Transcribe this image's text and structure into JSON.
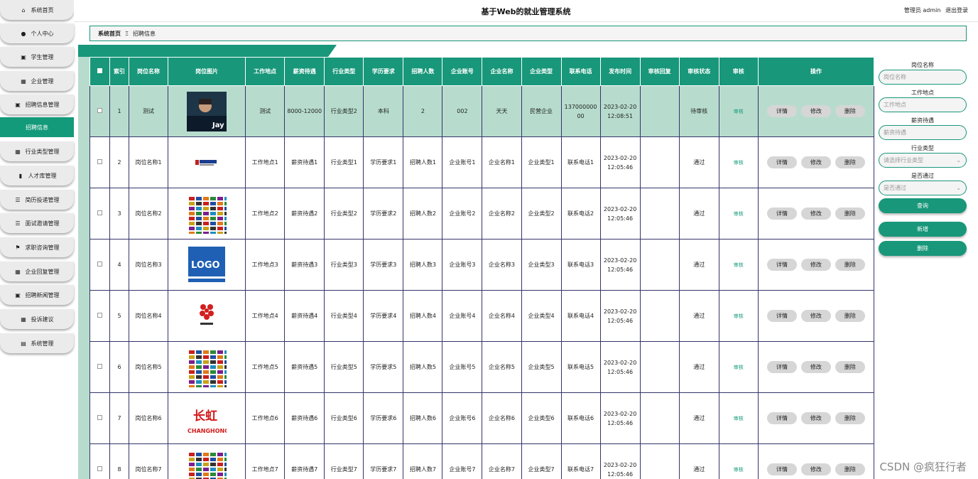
{
  "header": {
    "title": "基于Web的就业管理系统",
    "user": "管理员 admin",
    "logout": "退出登录"
  },
  "sidebar": {
    "items": [
      {
        "label": "系统首页",
        "icon": "home-icon",
        "glyph": "⌂"
      },
      {
        "label": "个人中心",
        "icon": "user-icon",
        "glyph": "●"
      },
      {
        "label": "学生管理",
        "icon": "clipboard-icon",
        "glyph": "▣"
      },
      {
        "label": "企业管理",
        "icon": "grid-icon",
        "glyph": "▦"
      },
      {
        "label": "招聘信息管理",
        "icon": "clipboard-icon",
        "glyph": "▣"
      },
      {
        "label": "招聘信息",
        "icon": "",
        "glyph": ""
      },
      {
        "label": "行业类型管理",
        "icon": "grid-icon",
        "glyph": "▦"
      },
      {
        "label": "人才库管理",
        "icon": "pin-icon",
        "glyph": "▮"
      },
      {
        "label": "简历投递管理",
        "icon": "list-icon",
        "glyph": "☰"
      },
      {
        "label": "面试邀请管理",
        "icon": "list-icon",
        "glyph": "☰"
      },
      {
        "label": "求职咨询管理",
        "icon": "flag-icon",
        "glyph": "⚑"
      },
      {
        "label": "企业回复管理",
        "icon": "grid-icon",
        "glyph": "▦"
      },
      {
        "label": "招聘新闻管理",
        "icon": "clipboard-icon",
        "glyph": "▣"
      },
      {
        "label": "投诉建议",
        "icon": "grid-icon",
        "glyph": "▦"
      },
      {
        "label": "系统管理",
        "icon": "server-icon",
        "glyph": "▤"
      }
    ]
  },
  "breadcrumb": {
    "home": "系统首页",
    "sep": "Ξ",
    "current": "招聘信息"
  },
  "table": {
    "headers": [
      "索引",
      "岗位名称",
      "岗位图片",
      "工作地点",
      "薪资待遇",
      "行业类型",
      "学历要求",
      "招聘人数",
      "企业账号",
      "企业名称",
      "企业类型",
      "联系电话",
      "发布时间",
      "审核回复",
      "审核状态",
      "审核",
      "操作"
    ],
    "audit_label": "审核",
    "actions": [
      "详情",
      "修改",
      "删除"
    ],
    "rows": [
      {
        "idx": "1",
        "name": "测试",
        "image": "photo-person",
        "place": "测试",
        "salary": "8000-12000",
        "industry": "行业类型2",
        "edu": "本科",
        "count": "2",
        "account": "002",
        "company": "天天",
        "ctype": "民营企业",
        "phone": "13700000000",
        "date": "2023-02-20",
        "time": "12:08:51",
        "reply": "",
        "status": "待审核"
      },
      {
        "idx": "2",
        "name": "岗位名称1",
        "image": "logo-banner",
        "place": "工作地点1",
        "salary": "薪资待遇1",
        "industry": "行业类型1",
        "edu": "学历要求1",
        "count": "招聘人数1",
        "account": "企业账号1",
        "company": "企业名称1",
        "ctype": "企业类型1",
        "phone": "联系电话1",
        "date": "2023-02-20",
        "time": "12:05:46",
        "reply": "",
        "status": "通过"
      },
      {
        "idx": "3",
        "name": "岗位名称2",
        "image": "logo-collage",
        "place": "工作地点2",
        "salary": "薪资待遇2",
        "industry": "行业类型2",
        "edu": "学历要求2",
        "count": "招聘人数2",
        "account": "企业账号2",
        "company": "企业名称2",
        "ctype": "企业类型2",
        "phone": "联系电话2",
        "date": "2023-02-20",
        "time": "12:05:46",
        "reply": "",
        "status": "通过"
      },
      {
        "idx": "4",
        "name": "岗位名称3",
        "image": "logo-blue",
        "place": "工作地点3",
        "salary": "薪资待遇3",
        "industry": "行业类型3",
        "edu": "学历要求3",
        "count": "招聘人数3",
        "account": "企业账号3",
        "company": "企业名称3",
        "ctype": "企业类型3",
        "phone": "联系电话3",
        "date": "2023-02-20",
        "time": "12:05:46",
        "reply": "",
        "status": "通过"
      },
      {
        "idx": "5",
        "name": "岗位名称4",
        "image": "logo-flower",
        "place": "工作地点4",
        "salary": "薪资待遇4",
        "industry": "行业类型4",
        "edu": "学历要求4",
        "count": "招聘人数4",
        "account": "企业账号4",
        "company": "企业名称4",
        "ctype": "企业类型4",
        "phone": "联系电话4",
        "date": "2023-02-20",
        "time": "12:05:46",
        "reply": "",
        "status": "通过"
      },
      {
        "idx": "6",
        "name": "岗位名称5",
        "image": "logo-collage",
        "place": "工作地点5",
        "salary": "薪资待遇5",
        "industry": "行业类型5",
        "edu": "学历要求5",
        "count": "招聘人数5",
        "account": "企业账号5",
        "company": "企业名称5",
        "ctype": "企业类型5",
        "phone": "联系电话5",
        "date": "2023-02-20",
        "time": "12:05:46",
        "reply": "",
        "status": "通过"
      },
      {
        "idx": "7",
        "name": "岗位名称6",
        "image": "logo-changhong",
        "place": "工作地点6",
        "salary": "薪资待遇6",
        "industry": "行业类型6",
        "edu": "学历要求6",
        "count": "招聘人数6",
        "account": "企业账号6",
        "company": "企业名称6",
        "ctype": "企业类型6",
        "phone": "联系电话6",
        "date": "2023-02-20",
        "time": "12:05:46",
        "reply": "",
        "status": "通过"
      },
      {
        "idx": "8",
        "name": "岗位名称7",
        "image": "logo-collage",
        "place": "工作地点7",
        "salary": "薪资待遇7",
        "industry": "行业类型7",
        "edu": "学历要求7",
        "count": "招聘人数7",
        "account": "企业账号7",
        "company": "企业名称7",
        "ctype": "企业类型7",
        "phone": "联系电话7",
        "date": "2023-02-20",
        "time": "12:05:46",
        "reply": "",
        "status": "通过"
      }
    ]
  },
  "images": {
    "jay_text": "Jay",
    "logo_text": "LOGO",
    "changhong_cn": "长虹",
    "changhong_en": "CHANGHONG"
  },
  "search": {
    "post_label": "岗位名称",
    "post_placeholder": "岗位名称",
    "place_label": "工作地点",
    "place_placeholder": "工作地点",
    "salary_label": "薪资待遇",
    "salary_placeholder": "薪资待遇",
    "industry_label": "行业类型",
    "industry_placeholder": "请选择行业类型",
    "pass_label": "是否通过",
    "pass_placeholder": "是否通过",
    "query_button": "查询",
    "add_button": "新增",
    "delete_button": "删除"
  },
  "watermark": "CSDN @疯狂行者",
  "colors": {
    "accent": "#18977a",
    "selected_row": "#b7dccd",
    "button": "#d6d6d6"
  }
}
